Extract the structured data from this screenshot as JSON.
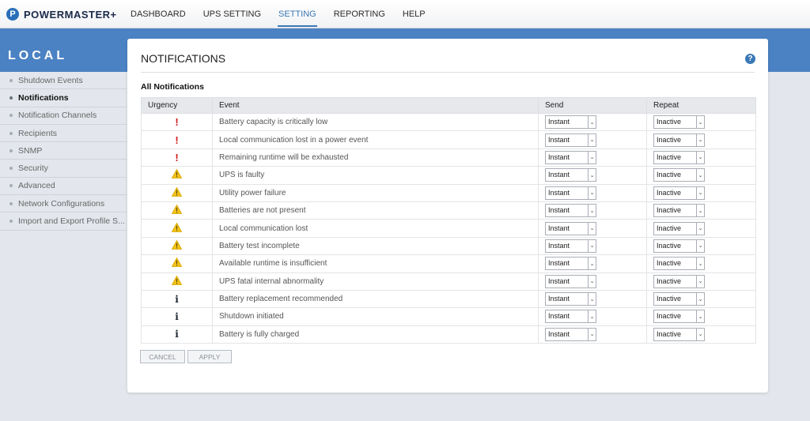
{
  "app": {
    "logo_mark": "P",
    "logo_text": "POWERMASTER+"
  },
  "nav": [
    "DASHBOARD",
    "UPS SETTING",
    "SETTING",
    "REPORTING",
    "HELP"
  ],
  "nav_active": 2,
  "band_title": "LOCAL",
  "sidebar": {
    "items": [
      {
        "label": "Shutdown Events"
      },
      {
        "label": "Notifications",
        "active": true
      },
      {
        "label": "Notification Channels"
      },
      {
        "label": "Recipients"
      },
      {
        "label": "SNMP"
      },
      {
        "label": "Security"
      },
      {
        "label": "Advanced"
      },
      {
        "label": "Network Configurations"
      },
      {
        "label": "Import and Export Profile S..."
      }
    ]
  },
  "page": {
    "title": "NOTIFICATIONS",
    "help_icon": "?",
    "section_title": "All Notifications",
    "columns": [
      "Urgency",
      "Event",
      "Send",
      "Repeat"
    ],
    "rows": [
      {
        "urgency": "critical",
        "event": "Battery capacity is critically low",
        "send": "Instant",
        "repeat": "Inactive"
      },
      {
        "urgency": "critical",
        "event": "Local communication lost in a power event",
        "send": "Instant",
        "repeat": "Inactive"
      },
      {
        "urgency": "critical",
        "event": "Remaining runtime will be exhausted",
        "send": "Instant",
        "repeat": "Inactive"
      },
      {
        "urgency": "warning",
        "event": "UPS is faulty",
        "send": "Instant",
        "repeat": "Inactive"
      },
      {
        "urgency": "warning",
        "event": "Utility power failure",
        "send": "Instant",
        "repeat": "Inactive"
      },
      {
        "urgency": "warning",
        "event": "Batteries are not present",
        "send": "Instant",
        "repeat": "Inactive"
      },
      {
        "urgency": "warning",
        "event": "Local communication lost",
        "send": "Instant",
        "repeat": "Inactive"
      },
      {
        "urgency": "warning",
        "event": "Battery test incomplete",
        "send": "Instant",
        "repeat": "Inactive"
      },
      {
        "urgency": "warning",
        "event": "Available runtime is insufficient",
        "send": "Instant",
        "repeat": "Inactive"
      },
      {
        "urgency": "warning",
        "event": "UPS fatal internal abnormality",
        "send": "Instant",
        "repeat": "Inactive"
      },
      {
        "urgency": "info",
        "event": "Battery replacement recommended",
        "send": "Instant",
        "repeat": "Inactive"
      },
      {
        "urgency": "info",
        "event": "Shutdown initiated",
        "send": "Instant",
        "repeat": "Inactive"
      },
      {
        "urgency": "info",
        "event": "Battery is fully charged",
        "send": "Instant",
        "repeat": "Inactive"
      }
    ],
    "buttons": {
      "cancel": "CANCEL",
      "apply": "APPLY"
    }
  },
  "colors": {
    "accent": "#3a78b5",
    "band": "#4b82c3",
    "critical": "#d21b1b",
    "warning": "#f2c21a"
  }
}
